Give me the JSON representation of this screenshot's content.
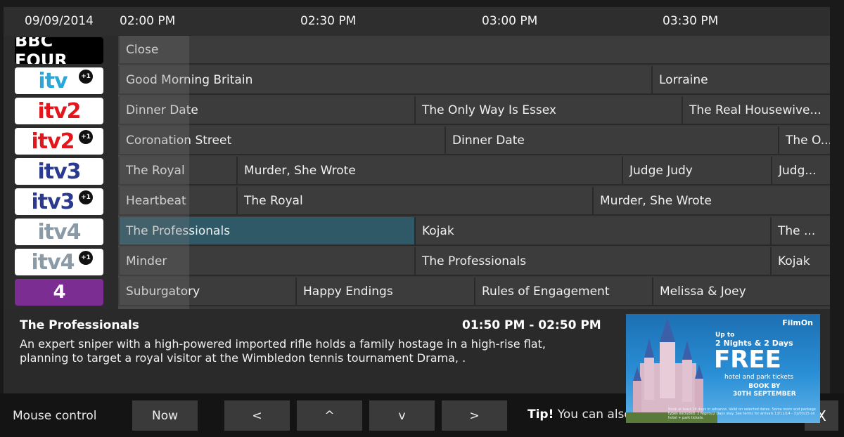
{
  "header": {
    "date": "09/09/2014",
    "times": [
      "02:00 PM",
      "02:30 PM",
      "03:00 PM",
      "03:30 PM"
    ]
  },
  "channels": [
    {
      "name": "BBC FOUR",
      "logo_text": "BBC FOUR",
      "plus_one": false,
      "color": "#000000",
      "bg": "#000000",
      "icon": "bbc-four-logo-icon"
    },
    {
      "name": "ITV +1",
      "logo_text": "itv",
      "plus_one": true,
      "color": "#2aa7d9",
      "bg": "#ffffff",
      "icon": "itv-plus1-logo-icon"
    },
    {
      "name": "ITV2",
      "logo_text": "itv2",
      "plus_one": false,
      "color": "#e3161b",
      "bg": "#ffffff",
      "icon": "itv2-logo-icon"
    },
    {
      "name": "ITV2 +1",
      "logo_text": "itv2",
      "plus_one": true,
      "color": "#e3161b",
      "bg": "#ffffff",
      "icon": "itv2-plus1-logo-icon"
    },
    {
      "name": "ITV3",
      "logo_text": "itv3",
      "plus_one": false,
      "color": "#2b3a8f",
      "bg": "#ffffff",
      "icon": "itv3-logo-icon"
    },
    {
      "name": "ITV3 +1",
      "logo_text": "itv3",
      "plus_one": true,
      "color": "#2b3a8f",
      "bg": "#ffffff",
      "icon": "itv3-plus1-logo-icon"
    },
    {
      "name": "ITV4",
      "logo_text": "itv4",
      "plus_one": false,
      "color": "#8a9aa6",
      "bg": "#ffffff",
      "icon": "itv4-logo-icon"
    },
    {
      "name": "ITV4 +1",
      "logo_text": "itv4",
      "plus_one": true,
      "color": "#8a9aa6",
      "bg": "#ffffff",
      "icon": "itv4-plus1-logo-icon"
    },
    {
      "name": "E4",
      "logo_text": "4",
      "plus_one": false,
      "color": "#ffffff",
      "bg": "#7b2d91",
      "icon": "e4-logo-icon"
    }
  ],
  "plus_one_label": "+1",
  "programmes": [
    [
      {
        "title": "Close",
        "start": "",
        "end": ""
      }
    ],
    [
      {
        "title": "Good Morning Britain"
      },
      {
        "title": "Lorraine"
      }
    ],
    [
      {
        "title": "Dinner Date"
      },
      {
        "title": "The Only Way Is Essex"
      },
      {
        "title": "The Real Housewive..."
      }
    ],
    [
      {
        "title": "Coronation Street"
      },
      {
        "title": "Dinner Date"
      },
      {
        "title": "The O..."
      }
    ],
    [
      {
        "title": "The Royal"
      },
      {
        "title": "Murder, She Wrote"
      },
      {
        "title": "Judge Judy"
      },
      {
        "title": "Judg..."
      }
    ],
    [
      {
        "title": "Heartbeat"
      },
      {
        "title": "The Royal"
      },
      {
        "title": "Murder, She Wrote"
      }
    ],
    [
      {
        "title": "The Professionals",
        "selected": true
      },
      {
        "title": "Kojak"
      },
      {
        "title": "The ..."
      }
    ],
    [
      {
        "title": "Minder"
      },
      {
        "title": "The Professionals"
      },
      {
        "title": "Kojak"
      }
    ],
    [
      {
        "title": "Suburgatory"
      },
      {
        "title": "Happy Endings"
      },
      {
        "title": "Rules of Engagement"
      },
      {
        "title": "Melissa & Joey"
      }
    ]
  ],
  "details": {
    "title": "The Professionals",
    "time": "01:50 PM - 02:50 PM",
    "description": "An expert sniper with a high-powered imported rifle holds a family hostage in a high-rise flat, planning to target a royal visitor at the Wimbledon tennis tournament Drama, ."
  },
  "ad": {
    "brand": "FilmOn",
    "up_to": "Up to",
    "nights": "2 Nights & 2 Days",
    "free": "FREE",
    "tickets": "hotel and park tickets",
    "book_by": "BOOK BY",
    "date": "30TH SEPTEMBER",
    "fine_print": "Book at least 14 days in advance. Valid on selected dates. Some room and package types excluded. 2 Nights/2 Days stay. See terms for arrivals 13/11/14 - 31/03/15 on hotel + park tickets."
  },
  "toolbar": {
    "mouse_control": "Mouse control",
    "now": "Now",
    "left": "<",
    "up": "^",
    "down": "v",
    "right": ">",
    "tip_bold": "Tip!",
    "tip_text": "You can also",
    "close": "X"
  },
  "colors": {
    "selected": "#2f5966",
    "cell": "#3c3c3c",
    "background": "#1a1a1a"
  }
}
